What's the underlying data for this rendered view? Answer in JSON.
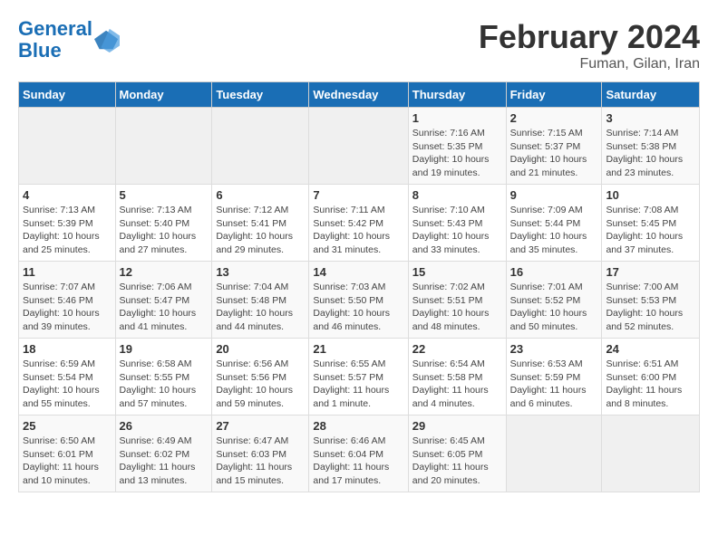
{
  "header": {
    "logo_line1": "General",
    "logo_line2": "Blue",
    "month_title": "February 2024",
    "location": "Fuman, Gilan, Iran"
  },
  "days_of_week": [
    "Sunday",
    "Monday",
    "Tuesday",
    "Wednesday",
    "Thursday",
    "Friday",
    "Saturday"
  ],
  "weeks": [
    [
      {
        "day": "",
        "info": ""
      },
      {
        "day": "",
        "info": ""
      },
      {
        "day": "",
        "info": ""
      },
      {
        "day": "",
        "info": ""
      },
      {
        "day": "1",
        "info": "Sunrise: 7:16 AM\nSunset: 5:35 PM\nDaylight: 10 hours\nand 19 minutes."
      },
      {
        "day": "2",
        "info": "Sunrise: 7:15 AM\nSunset: 5:37 PM\nDaylight: 10 hours\nand 21 minutes."
      },
      {
        "day": "3",
        "info": "Sunrise: 7:14 AM\nSunset: 5:38 PM\nDaylight: 10 hours\nand 23 minutes."
      }
    ],
    [
      {
        "day": "4",
        "info": "Sunrise: 7:13 AM\nSunset: 5:39 PM\nDaylight: 10 hours\nand 25 minutes."
      },
      {
        "day": "5",
        "info": "Sunrise: 7:13 AM\nSunset: 5:40 PM\nDaylight: 10 hours\nand 27 minutes."
      },
      {
        "day": "6",
        "info": "Sunrise: 7:12 AM\nSunset: 5:41 PM\nDaylight: 10 hours\nand 29 minutes."
      },
      {
        "day": "7",
        "info": "Sunrise: 7:11 AM\nSunset: 5:42 PM\nDaylight: 10 hours\nand 31 minutes."
      },
      {
        "day": "8",
        "info": "Sunrise: 7:10 AM\nSunset: 5:43 PM\nDaylight: 10 hours\nand 33 minutes."
      },
      {
        "day": "9",
        "info": "Sunrise: 7:09 AM\nSunset: 5:44 PM\nDaylight: 10 hours\nand 35 minutes."
      },
      {
        "day": "10",
        "info": "Sunrise: 7:08 AM\nSunset: 5:45 PM\nDaylight: 10 hours\nand 37 minutes."
      }
    ],
    [
      {
        "day": "11",
        "info": "Sunrise: 7:07 AM\nSunset: 5:46 PM\nDaylight: 10 hours\nand 39 minutes."
      },
      {
        "day": "12",
        "info": "Sunrise: 7:06 AM\nSunset: 5:47 PM\nDaylight: 10 hours\nand 41 minutes."
      },
      {
        "day": "13",
        "info": "Sunrise: 7:04 AM\nSunset: 5:48 PM\nDaylight: 10 hours\nand 44 minutes."
      },
      {
        "day": "14",
        "info": "Sunrise: 7:03 AM\nSunset: 5:50 PM\nDaylight: 10 hours\nand 46 minutes."
      },
      {
        "day": "15",
        "info": "Sunrise: 7:02 AM\nSunset: 5:51 PM\nDaylight: 10 hours\nand 48 minutes."
      },
      {
        "day": "16",
        "info": "Sunrise: 7:01 AM\nSunset: 5:52 PM\nDaylight: 10 hours\nand 50 minutes."
      },
      {
        "day": "17",
        "info": "Sunrise: 7:00 AM\nSunset: 5:53 PM\nDaylight: 10 hours\nand 52 minutes."
      }
    ],
    [
      {
        "day": "18",
        "info": "Sunrise: 6:59 AM\nSunset: 5:54 PM\nDaylight: 10 hours\nand 55 minutes."
      },
      {
        "day": "19",
        "info": "Sunrise: 6:58 AM\nSunset: 5:55 PM\nDaylight: 10 hours\nand 57 minutes."
      },
      {
        "day": "20",
        "info": "Sunrise: 6:56 AM\nSunset: 5:56 PM\nDaylight: 10 hours\nand 59 minutes."
      },
      {
        "day": "21",
        "info": "Sunrise: 6:55 AM\nSunset: 5:57 PM\nDaylight: 11 hours\nand 1 minute."
      },
      {
        "day": "22",
        "info": "Sunrise: 6:54 AM\nSunset: 5:58 PM\nDaylight: 11 hours\nand 4 minutes."
      },
      {
        "day": "23",
        "info": "Sunrise: 6:53 AM\nSunset: 5:59 PM\nDaylight: 11 hours\nand 6 minutes."
      },
      {
        "day": "24",
        "info": "Sunrise: 6:51 AM\nSunset: 6:00 PM\nDaylight: 11 hours\nand 8 minutes."
      }
    ],
    [
      {
        "day": "25",
        "info": "Sunrise: 6:50 AM\nSunset: 6:01 PM\nDaylight: 11 hours\nand 10 minutes."
      },
      {
        "day": "26",
        "info": "Sunrise: 6:49 AM\nSunset: 6:02 PM\nDaylight: 11 hours\nand 13 minutes."
      },
      {
        "day": "27",
        "info": "Sunrise: 6:47 AM\nSunset: 6:03 PM\nDaylight: 11 hours\nand 15 minutes."
      },
      {
        "day": "28",
        "info": "Sunrise: 6:46 AM\nSunset: 6:04 PM\nDaylight: 11 hours\nand 17 minutes."
      },
      {
        "day": "29",
        "info": "Sunrise: 6:45 AM\nSunset: 6:05 PM\nDaylight: 11 hours\nand 20 minutes."
      },
      {
        "day": "",
        "info": ""
      },
      {
        "day": "",
        "info": ""
      }
    ]
  ]
}
